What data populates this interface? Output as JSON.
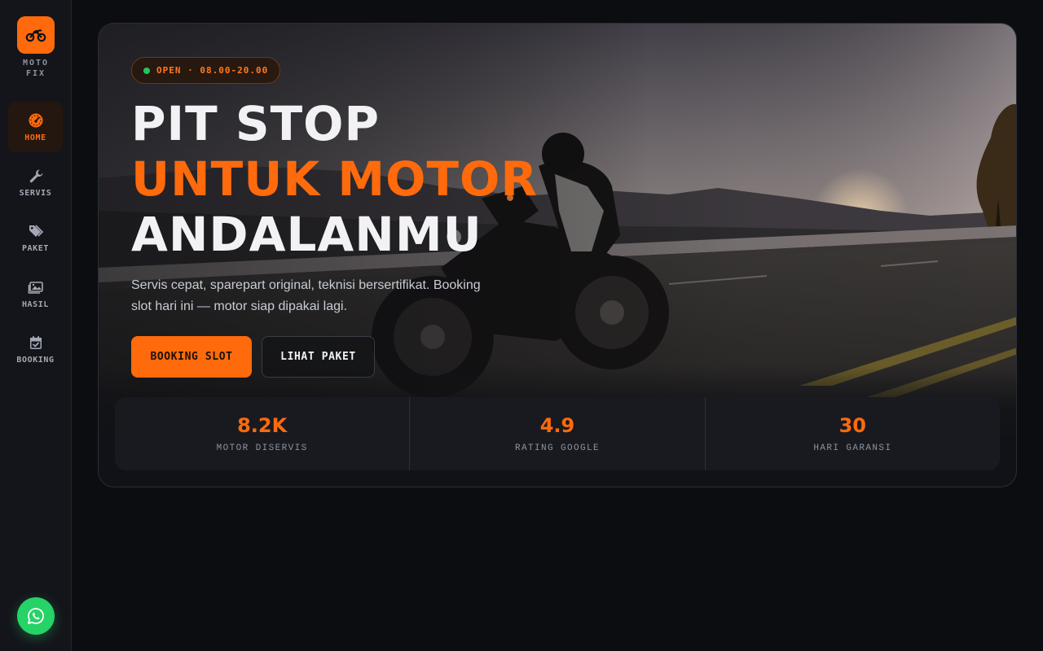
{
  "brand": {
    "line1": "MOTO",
    "line2": "FIX",
    "accent": "#ff6a0c"
  },
  "sidebar": {
    "items": [
      {
        "label": "HOME",
        "icon": "speedometer-icon",
        "active": true
      },
      {
        "label": "SERVIS",
        "icon": "wrench-icon",
        "active": false
      },
      {
        "label": "PAKET",
        "icon": "tags-icon",
        "active": false
      },
      {
        "label": "HASIL",
        "icon": "images-icon",
        "active": false
      },
      {
        "label": "BOOKING",
        "icon": "calendar-check-icon",
        "active": false
      }
    ],
    "whatsapp_icon": "whatsapp-icon"
  },
  "hero": {
    "badge": "OPEN · 08.00-20.00",
    "title_line1": "PIT STOP",
    "title_line2": "UNTUK MOTOR",
    "title_line3": "ANDALANMU",
    "description": "Servis cepat, sparepart original, teknisi bersertifikat. Booking slot hari ini — motor siap dipakai lagi.",
    "primary_button": "BOOKING SLOT",
    "secondary_button": "LIHAT PAKET"
  },
  "stats": [
    {
      "value": "8.2K",
      "label": "MOTOR DISERVIS"
    },
    {
      "value": "4.9",
      "label": "RATING GOOGLE"
    },
    {
      "value": "30",
      "label": "HARI GARANSI"
    }
  ]
}
